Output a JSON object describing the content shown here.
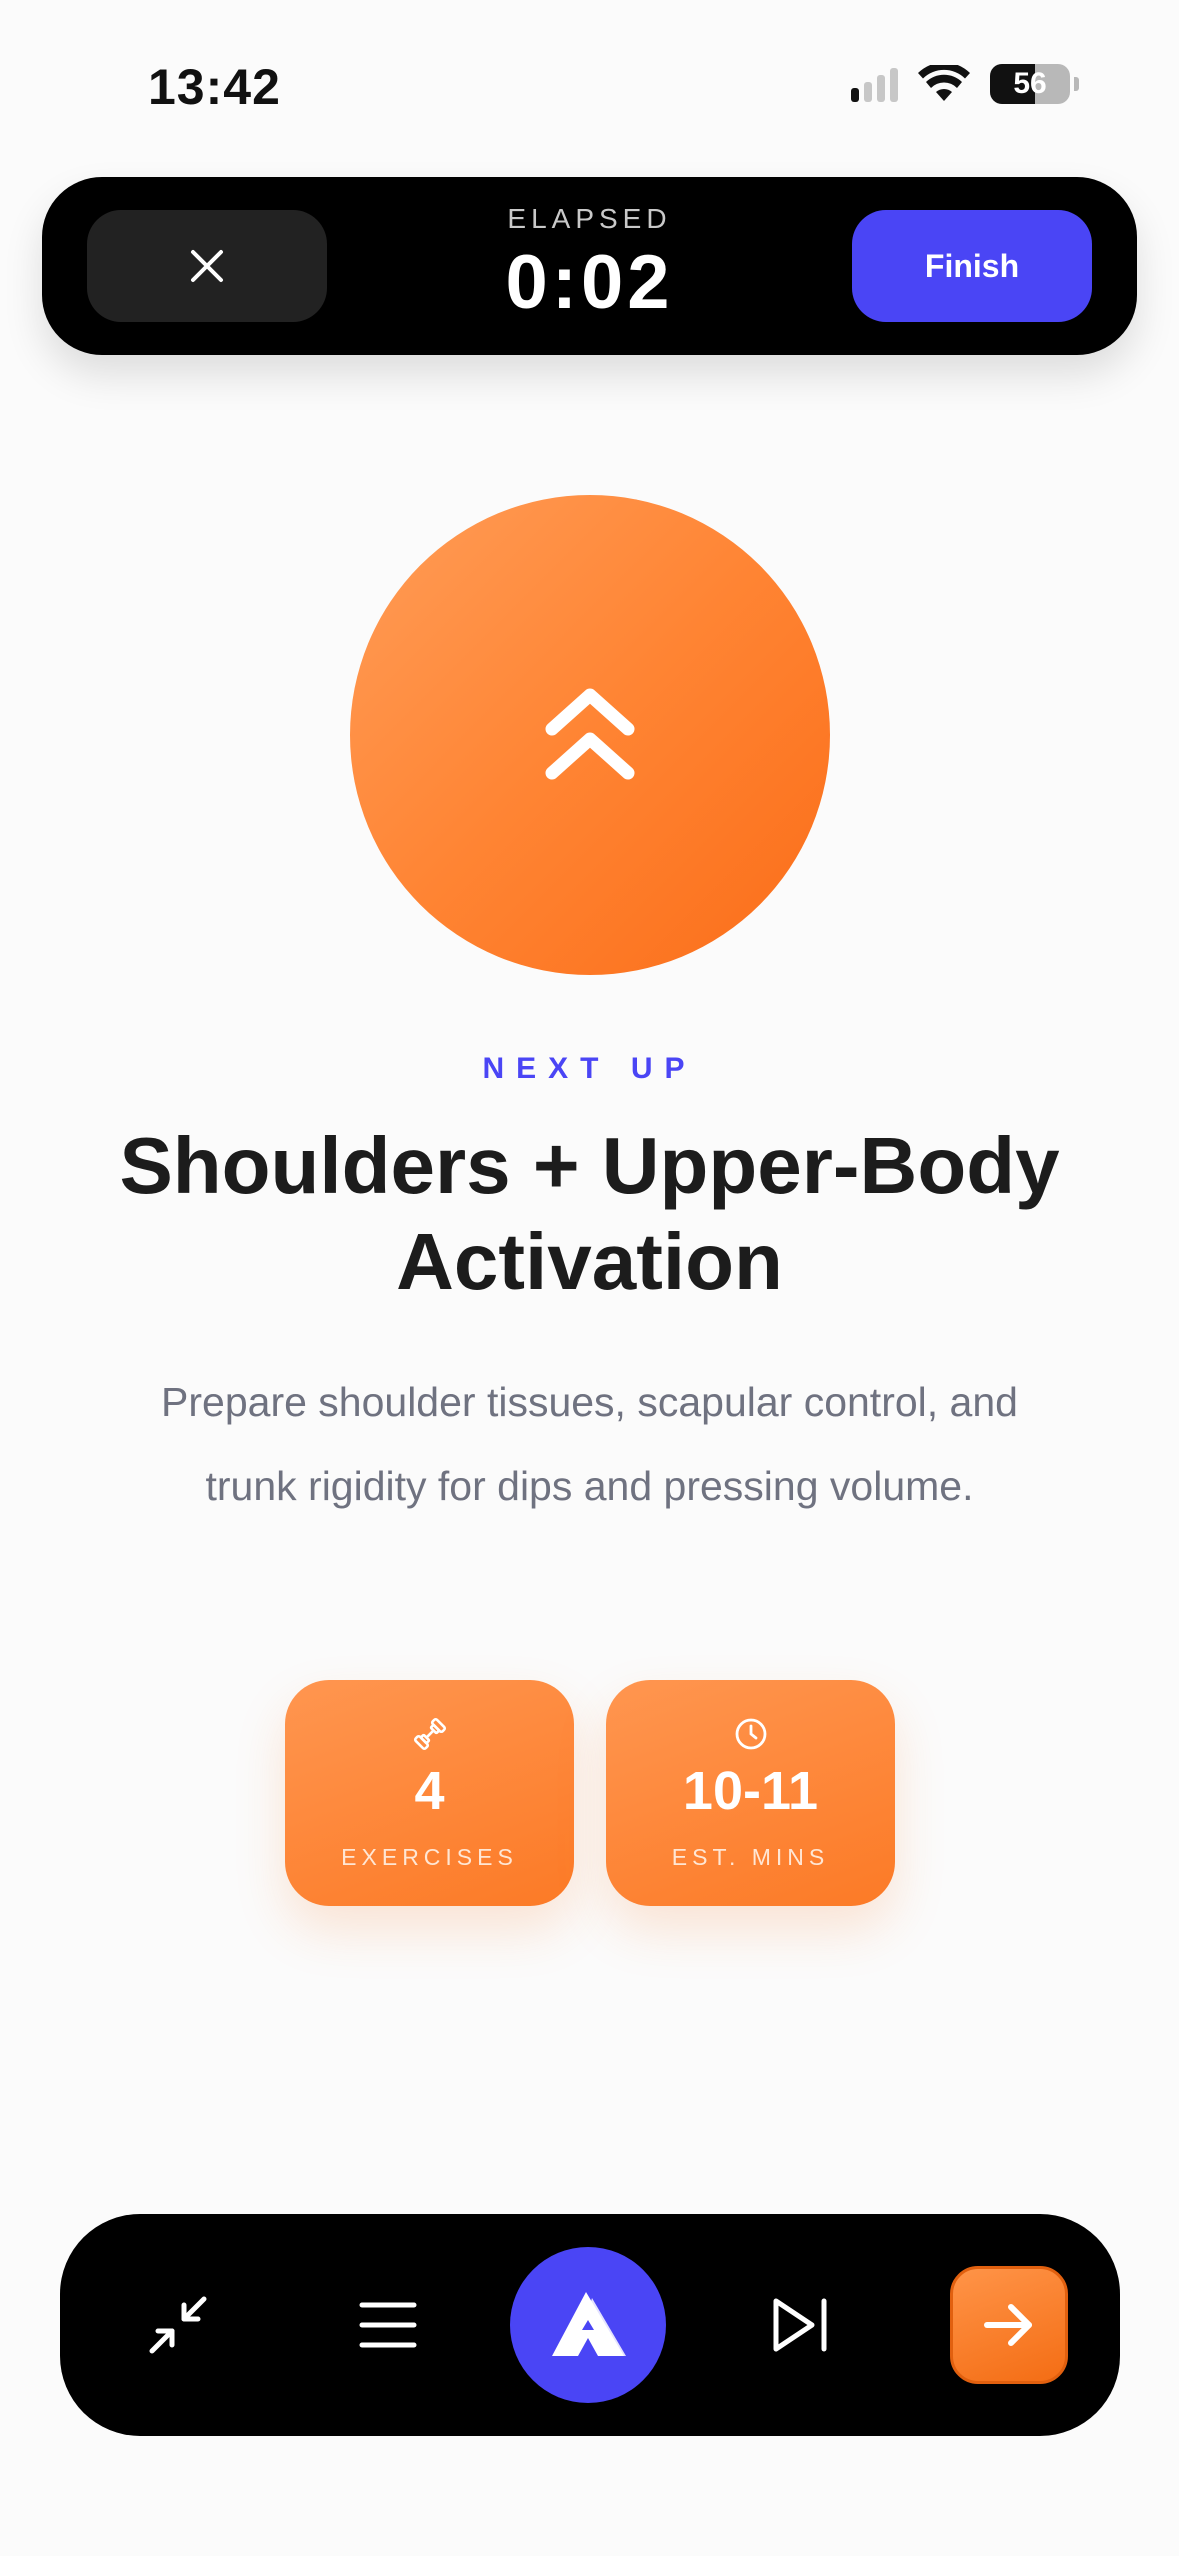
{
  "status_bar": {
    "time": "13:42",
    "battery": 56
  },
  "top_bar": {
    "elapsed_label": "ELAPSED",
    "elapsed_value": "0:02",
    "finish_label": "Finish"
  },
  "hero": {
    "icon": "double-chevron-up-icon",
    "next_up_label": "NEXT UP",
    "title": "Shoulders + Upper-Body Activation",
    "description": "Prepare shoulder tissues, scapular control, and trunk rigidity for dips and pressing volume."
  },
  "stats": [
    {
      "icon": "dumbbell-icon",
      "value": "4",
      "label": "EXERCISES"
    },
    {
      "icon": "clock-icon",
      "value": "10-11",
      "label": "EST. MINS"
    }
  ],
  "bottom_nav": {
    "items": [
      {
        "icon": "collapse-arrows-icon"
      },
      {
        "icon": "list-menu-icon"
      },
      {
        "icon": "app-logo-icon"
      },
      {
        "icon": "skip-next-icon"
      },
      {
        "icon": "arrow-right-icon"
      }
    ]
  },
  "colors": {
    "accent": "#4a45f5",
    "orange": "#fc7a26",
    "bar": "#000000",
    "text": "#1c1c1c",
    "muted": "#6f7280"
  }
}
